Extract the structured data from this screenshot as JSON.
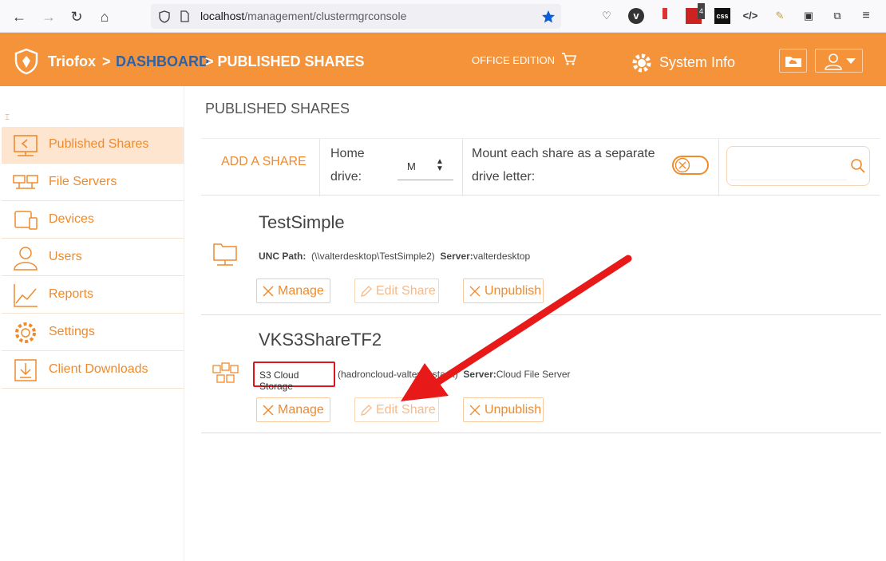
{
  "browser": {
    "url_host": "localhost",
    "url_path": "/management/clustermgrconsole",
    "ext_badge": "4",
    "ext_css": "css"
  },
  "header": {
    "brand": "Triofox",
    "sep1": ">",
    "dashboard": "DASHBOARD",
    "current": "> PUBLISHED SHARES",
    "edition": "OFFICE EDITION",
    "system_info": "System Info",
    "brand_color": "#f5933b"
  },
  "sidebar": {
    "items": [
      {
        "label": "Published Shares",
        "icon": "published-shares-icon"
      },
      {
        "label": "File Servers",
        "icon": "file-servers-icon"
      },
      {
        "label": "Devices",
        "icon": "devices-icon"
      },
      {
        "label": "Users",
        "icon": "users-icon"
      },
      {
        "label": "Reports",
        "icon": "reports-icon"
      },
      {
        "label": "Settings",
        "icon": "settings-icon"
      },
      {
        "label": "Client Downloads",
        "icon": "client-downloads-icon"
      }
    ]
  },
  "main": {
    "title": "PUBLISHED SHARES",
    "toolbar": {
      "add_share": "ADD A SHARE",
      "home_drive_label1": "Home",
      "home_drive_label2": "drive:",
      "home_drive_value": "M",
      "mount_label1": "Mount each share as a separate",
      "mount_label2": "drive letter:",
      "search_placeholder": ""
    },
    "shares": [
      {
        "name": "TestSimple",
        "type_label": "UNC Path:",
        "path": "(\\\\valterdesktop\\TestSimple2)",
        "server_label": "Server:",
        "server": "valterdesktop"
      },
      {
        "name": "VKS3ShareTF2",
        "type_label": "S3 Cloud Storage",
        "path": "(hadroncloud-valterlocstack)",
        "server_label": "Server:",
        "server": "Cloud File Server"
      }
    ],
    "buttons": {
      "manage": "Manage",
      "edit": "Edit Share",
      "unpublish": "Unpublish"
    }
  }
}
